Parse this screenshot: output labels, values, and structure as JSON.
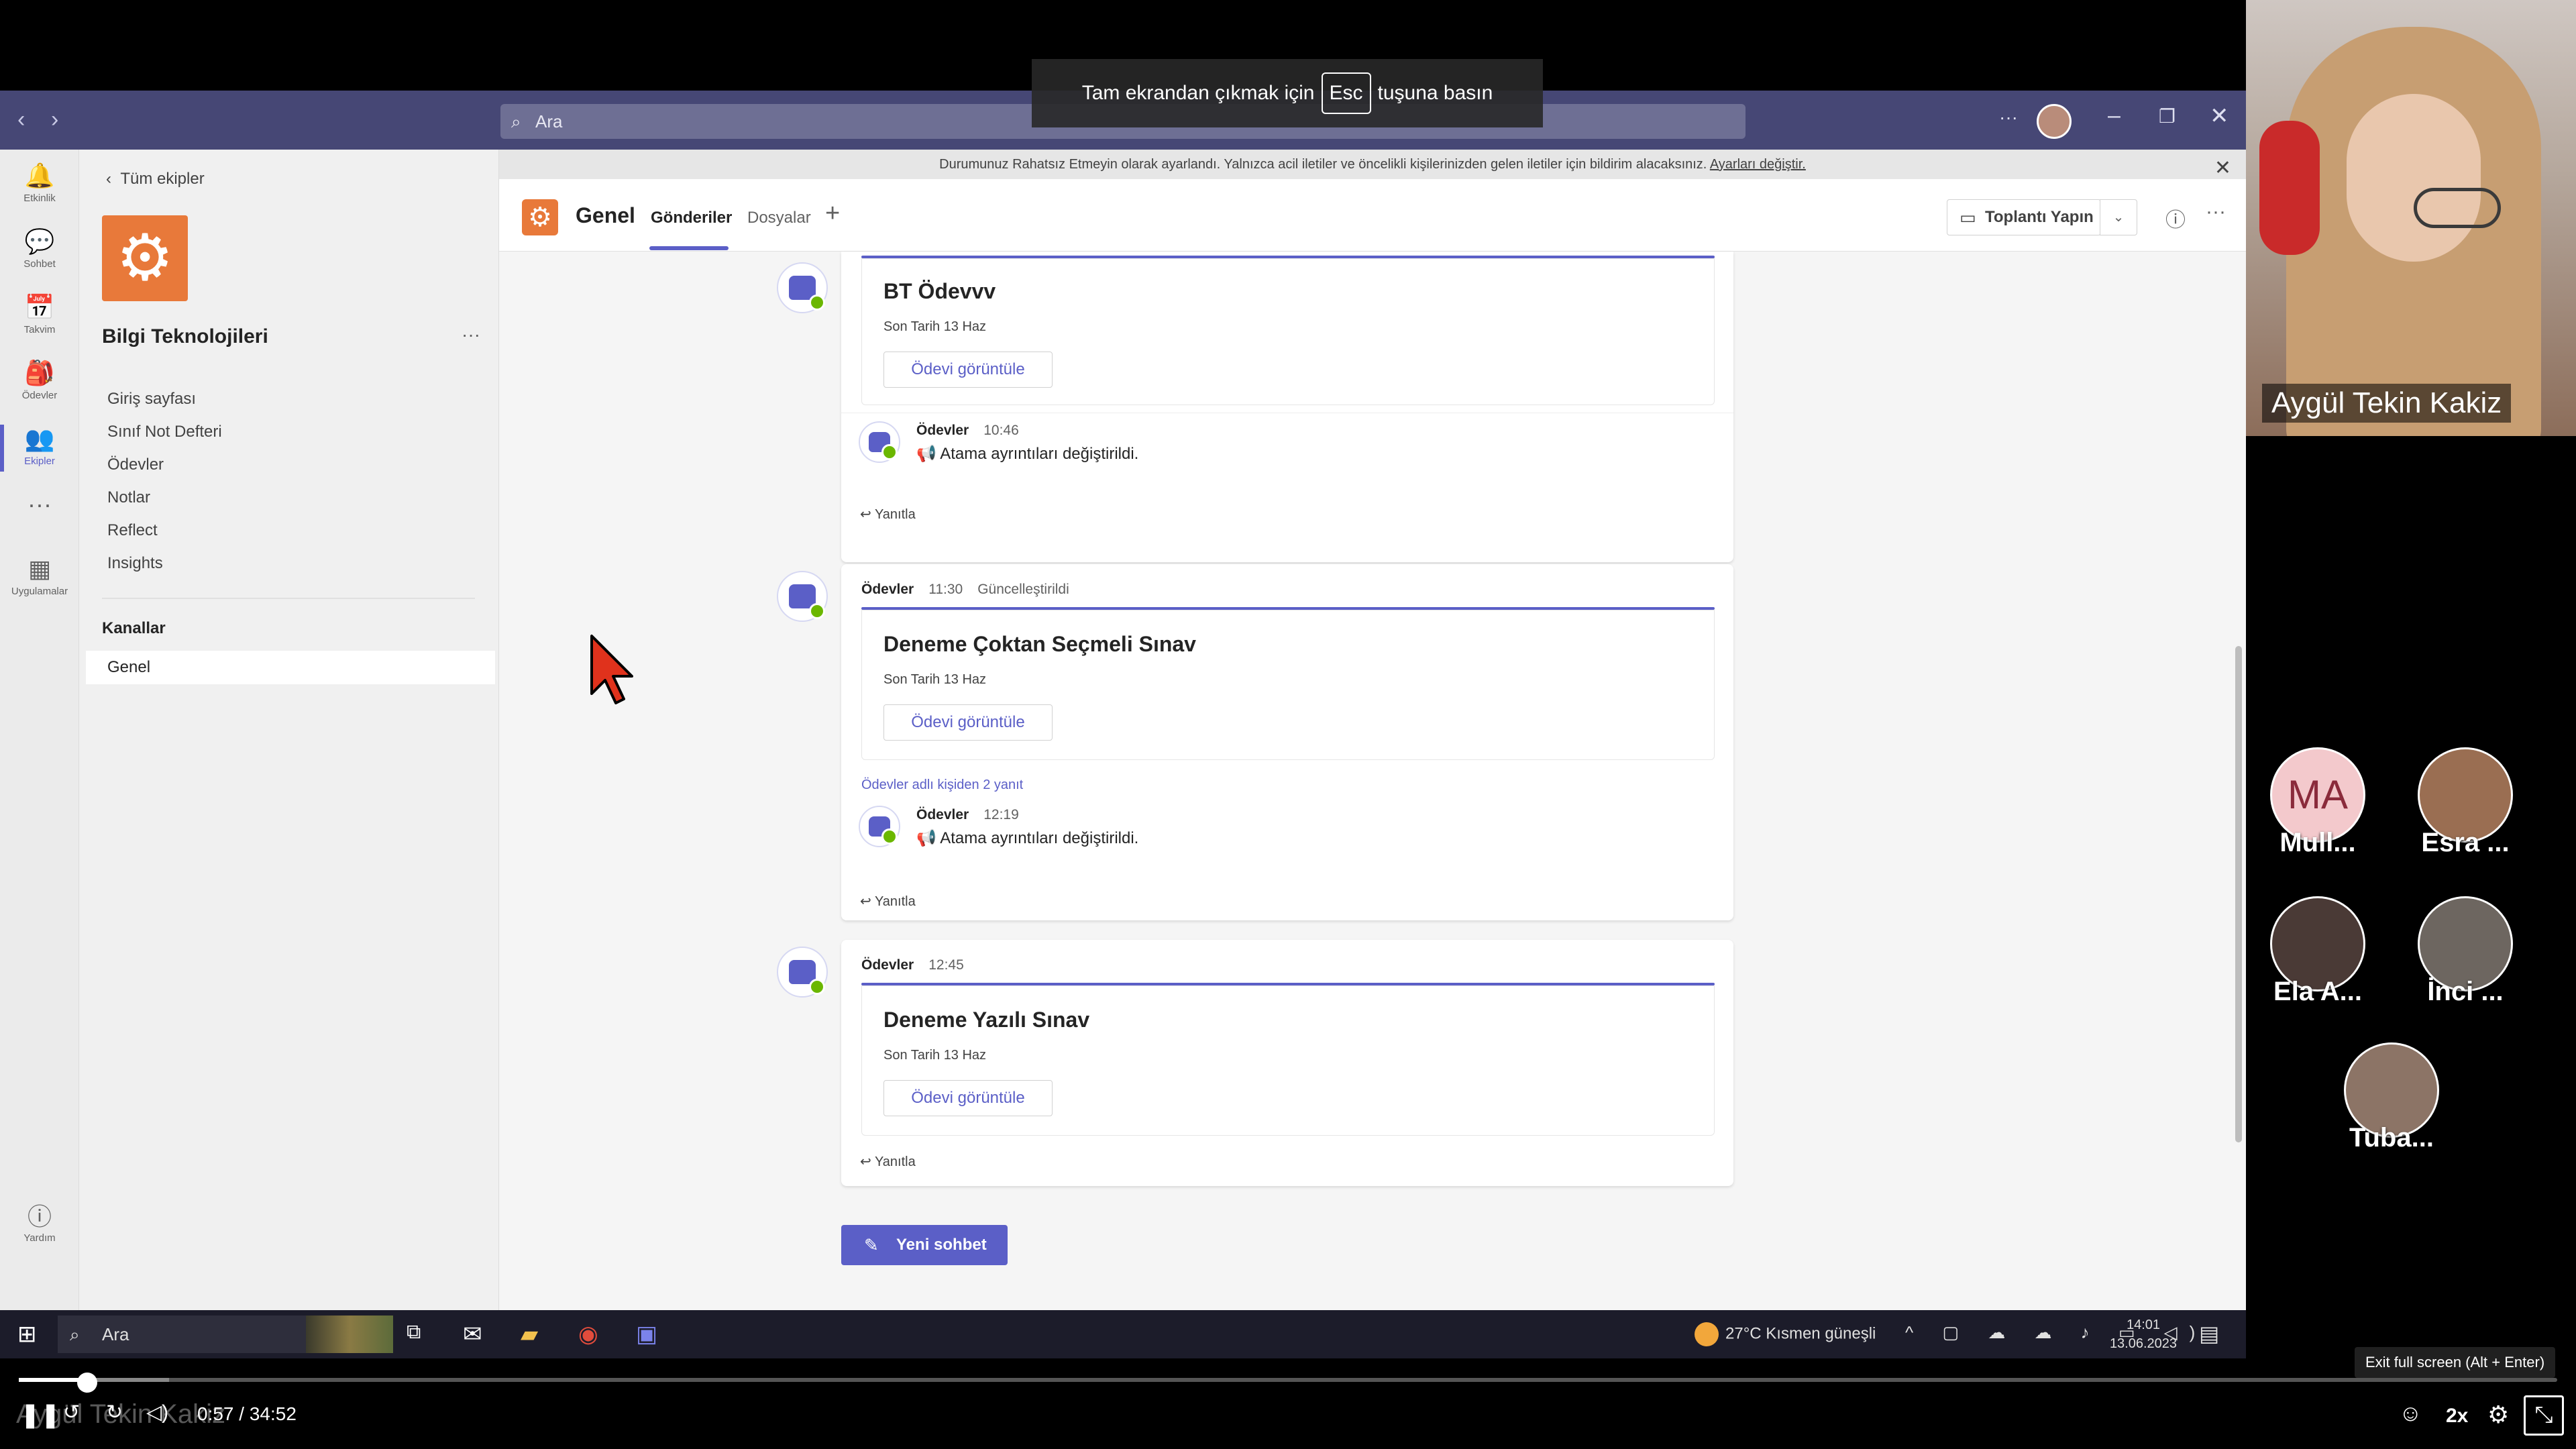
{
  "fullscreen_banner": {
    "before": "Tam ekrandan çıkmak için",
    "key": "Esc",
    "after": "tuşuna basın"
  },
  "titlebar": {
    "search_placeholder": "Ara"
  },
  "rail": [
    {
      "label": "Etkinlik",
      "icon": "bell-icon",
      "glyph": "🔔"
    },
    {
      "label": "Sohbet",
      "icon": "chat-icon",
      "glyph": "💬"
    },
    {
      "label": "Takvim",
      "icon": "calendar-icon",
      "glyph": "📅"
    },
    {
      "label": "Ödevler",
      "icon": "assignments-icon",
      "glyph": "🎒"
    },
    {
      "label": "Ekipler",
      "icon": "teams-icon",
      "glyph": "👥"
    },
    {
      "label": "Uygulamalar",
      "icon": "apps-icon",
      "glyph": "▦"
    }
  ],
  "help_label": "Yardım",
  "team": {
    "back": "Tüm ekipler",
    "name": "Bilgi Teknolojileri",
    "tabs": [
      "Giriş sayfası",
      "Sınıf Not Defteri",
      "Ödevler",
      "Notlar",
      "Reflect",
      "Insights"
    ],
    "channels_header": "Kanallar",
    "channel": "Genel"
  },
  "dnd": {
    "text": "Durumunuz Rahatsız Etmeyin olarak ayarlandı. Yalnızca acil iletiler ve öncelikli kişilerinizden gelen iletiler için bildirim alacaksınız.",
    "link": "Ayarları değiştir."
  },
  "channel": {
    "name": "Genel",
    "tabs": [
      "Gönderiler",
      "Dosyalar"
    ],
    "meet": "Toplantı Yapın"
  },
  "posts": [
    {
      "title": "BT Ödevvv",
      "due": "Son Tarih 13 Haz",
      "button": "Ödevi görüntüle",
      "reply": {
        "author": "Ödevler",
        "time": "10:46",
        "text": "📢 Atama ayrıntıları değiştirildi."
      },
      "reply_label": "Yanıtla"
    },
    {
      "author": "Ödevler",
      "time": "11:30",
      "status": "Güncelleştirildi",
      "title": "Deneme Çoktan Seçmeli Sınav",
      "due": "Son Tarih 13 Haz",
      "button": "Ödevi görüntüle",
      "replies_note": "Ödevler adlı kişiden 2 yanıt",
      "reply": {
        "author": "Ödevler",
        "time": "12:19",
        "text": "📢 Atama ayrıntıları değiştirildi."
      },
      "reply_label": "Yanıtla"
    },
    {
      "author": "Ödevler",
      "time": "12:45",
      "title": "Deneme Yazılı Sınav",
      "due": "Son Tarih 13 Haz",
      "button": "Ödevi görüntüle",
      "reply_label": "Yanıtla"
    }
  ],
  "new_chat": "Yeni sohbet",
  "taskbar": {
    "search": "Ara",
    "weather": "27°C  Kısmen güneşli",
    "time": "14:01",
    "date": "13.06.2023"
  },
  "video": {
    "main_name": "Aygül Tekin Kakiz",
    "participants": [
      {
        "initials": "MA",
        "name": "Mull..."
      },
      {
        "name": "Esra ..."
      },
      {
        "name": "Ela A..."
      },
      {
        "name": "İnci ..."
      },
      {
        "name": "Tuba..."
      }
    ]
  },
  "player": {
    "time": "0:57 / 34:52",
    "speed": "2x",
    "ghost": "Aygül Tekin Kakiz",
    "exit_tooltip": "Exit full screen (Alt + Enter)",
    "progress": 0.027
  }
}
